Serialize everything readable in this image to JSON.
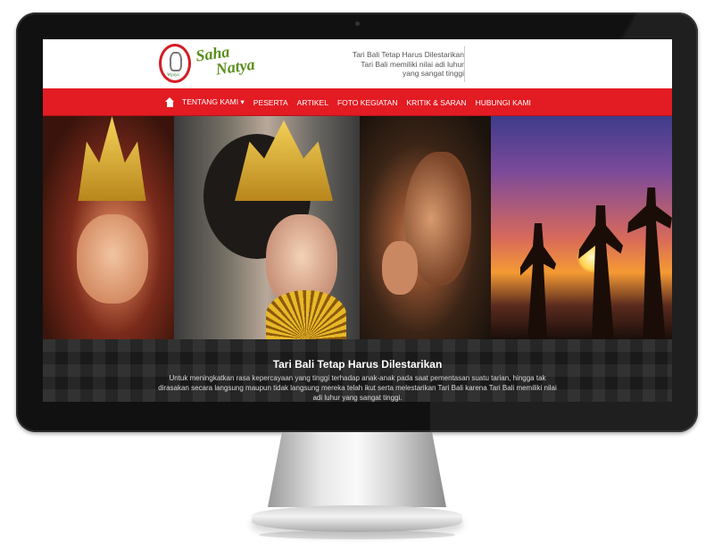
{
  "header": {
    "logo_small_text": "Wijaya",
    "logo_text_line1": "Saha",
    "logo_text_line2": "Natya",
    "tagline_line1": "Tari Bali Tetap Harus Dilestarikan",
    "tagline_line2": "Tari Bali memiliki nilai adi luhur",
    "tagline_line3": "yang sangat tinggi"
  },
  "nav": {
    "items": [
      {
        "label": "TENTANG KAMI ▾"
      },
      {
        "label": "PESERTA"
      },
      {
        "label": "ARTIKEL"
      },
      {
        "label": "FOTO KEGIATAN"
      },
      {
        "label": "KRITIK & SARAN"
      },
      {
        "label": "HUBUNGI KAMI"
      }
    ]
  },
  "slider": {
    "title": "Tari Bali Tetap Harus Dilestarikan",
    "text": "Untuk meningkatkan rasa kepercayaan yang tinggi terhadap anak-anak pada saat pementasan suatu tarian, hingga tak dirasakan secara langsung maupun tidak langsung mereka telah ikut serta melestarikan Tari Bali karena Tari Bali memiliki nilai adi luhur yang sangat tinggi."
  },
  "colors": {
    "nav_bg": "#e31b23",
    "logo_green": "#5a8e1c",
    "caption_bg": "#1a1a1a"
  }
}
